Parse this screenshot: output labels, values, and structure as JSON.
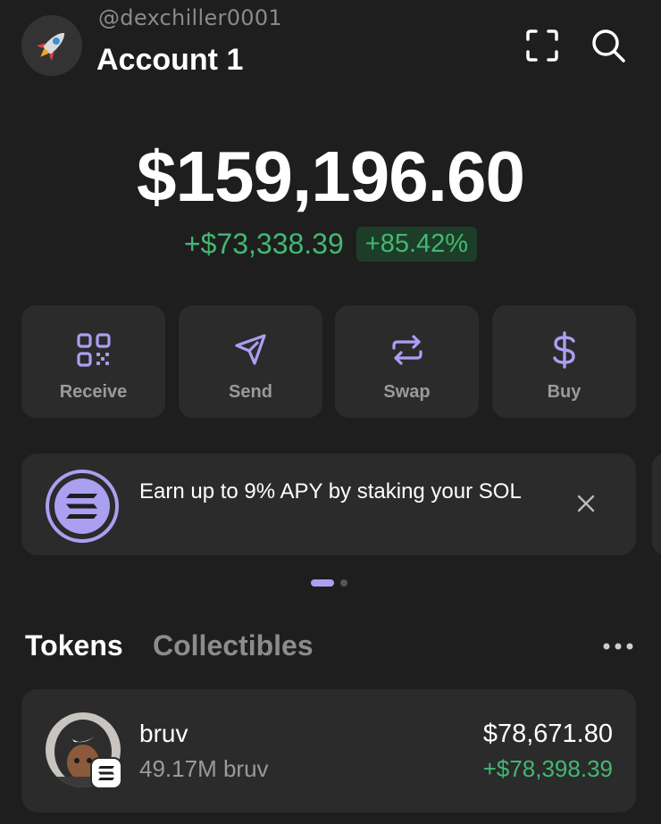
{
  "watermark": "@dexchiller0001",
  "header": {
    "account_name": "Account 1",
    "avatar_icon": "rocket-icon",
    "scan_icon": "scan-icon",
    "search_icon": "search-icon"
  },
  "balance": {
    "total": "$159,196.60",
    "change_amount": "+$73,338.39",
    "change_percent": "+85.42%"
  },
  "actions": [
    {
      "label": "Receive",
      "icon": "qr-code-icon"
    },
    {
      "label": "Send",
      "icon": "send-icon"
    },
    {
      "label": "Swap",
      "icon": "swap-icon"
    },
    {
      "label": "Buy",
      "icon": "dollar-icon"
    }
  ],
  "promo": {
    "text": "Earn up to 9% APY by staking your SOL",
    "icon": "solana-logo-icon",
    "close_icon": "close-icon"
  },
  "pager": {
    "current": 1,
    "total": 2
  },
  "tabs": {
    "tokens": "Tokens",
    "collectibles": "Collectibles"
  },
  "tokens": [
    {
      "name": "bruv",
      "amount": "49.17M bruv",
      "value": "$78,671.80",
      "change": "+$78,398.39",
      "chain_icon": "solana-badge-icon"
    }
  ],
  "colors": {
    "background": "#1e1e1e",
    "card": "#2b2b2b",
    "accent": "#ab9ff2",
    "positive": "#42b872"
  }
}
